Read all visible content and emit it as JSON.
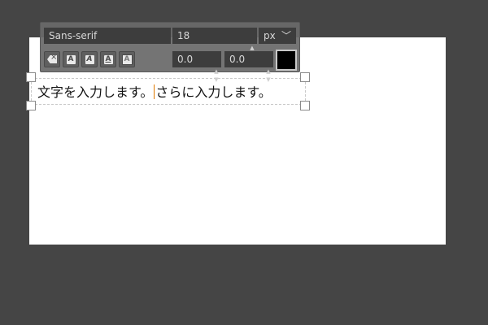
{
  "canvas": {
    "text_before_caret": "文字を入力します。",
    "text_after_caret": "さらに入力します。"
  },
  "toolbar": {
    "font_name": "Sans-serif",
    "font_size": "18",
    "unit": "px",
    "offset_a": "0.0",
    "offset_b": "0.0",
    "text_color": "#000000",
    "style_buttons": [
      {
        "icon": "clear-style-icon"
      },
      {
        "icon": "bold-icon",
        "glyph": "A"
      },
      {
        "icon": "italic-icon",
        "glyph": "A"
      },
      {
        "icon": "underline-icon",
        "glyph": "A"
      },
      {
        "icon": "outline-icon",
        "glyph": "A"
      }
    ]
  },
  "colors": {
    "background": "#454545",
    "canvas": "#ffffff",
    "caret": "#e07b00"
  }
}
